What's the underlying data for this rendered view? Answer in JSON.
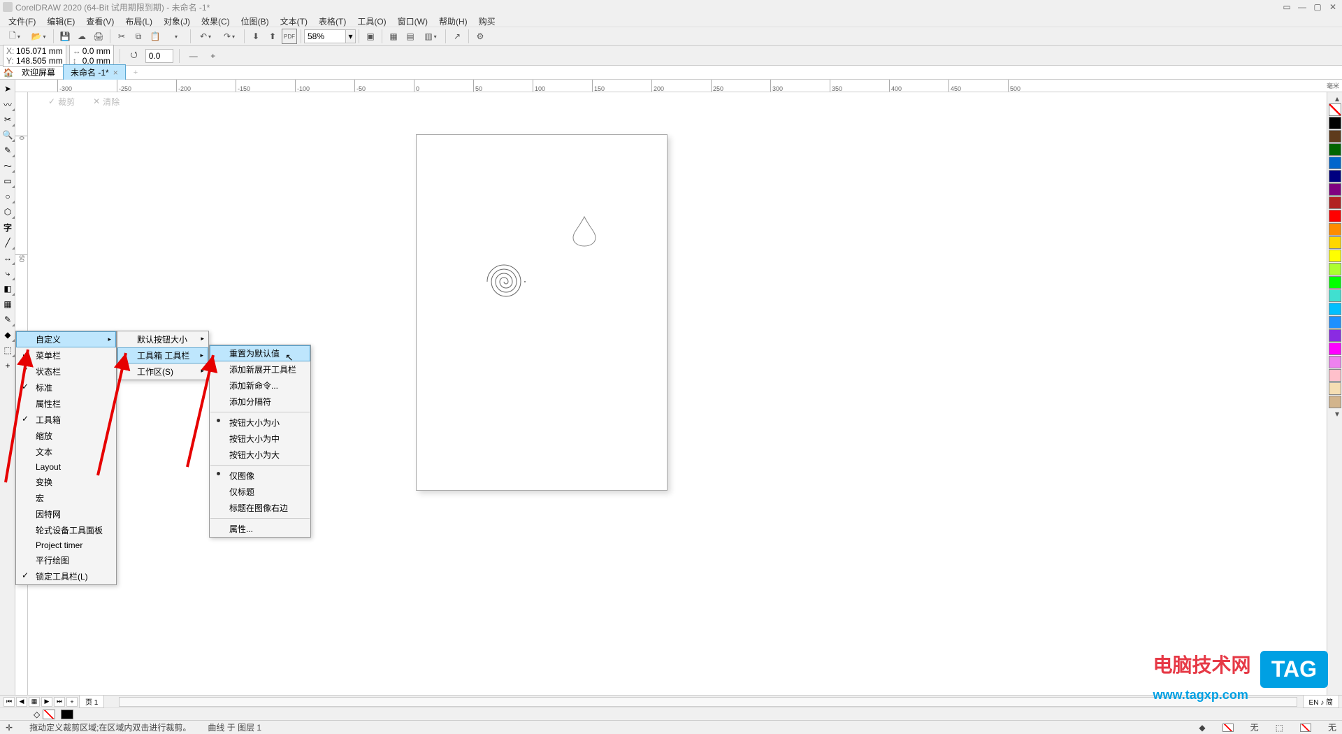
{
  "titlebar": {
    "title": "CorelDRAW 2020 (64-Bit 试用期限到期) - 未命名 -1*"
  },
  "menubar": {
    "items": [
      "文件(F)",
      "编辑(E)",
      "查看(V)",
      "布局(L)",
      "对象(J)",
      "效果(C)",
      "位图(B)",
      "文本(T)",
      "表格(T)",
      "工具(O)",
      "窗口(W)",
      "帮助(H)",
      "购买"
    ]
  },
  "toolbar": {
    "zoom": "58%"
  },
  "propbar": {
    "x_label": "X:",
    "x_val": "105.071 mm",
    "y_label": "Y:",
    "y_val": "148.505 mm",
    "w_label": "↔",
    "w_val": "0.0 mm",
    "h_label": "↕",
    "h_val": "0.0 mm",
    "angle": "0.0"
  },
  "tabs": {
    "welcome": "欢迎屏幕",
    "doc": "未命名 -1*"
  },
  "cropbar": {
    "crop": "裁剪",
    "clear": "清除"
  },
  "ruler_h": [
    "-300",
    "-250",
    "-200",
    "-150",
    "-100",
    "-50",
    "0",
    "50",
    "100",
    "150",
    "200",
    "250",
    "300",
    "350",
    "400",
    "450",
    "500"
  ],
  "ruler_h_unit": "毫米",
  "ruler_v": [
    "0",
    "50"
  ],
  "ctx1": {
    "items": [
      {
        "label": "自定义",
        "arrow": true,
        "hl": true
      },
      {
        "label": "菜单栏",
        "check": true
      },
      {
        "label": "状态栏",
        "check": true
      },
      {
        "label": "标准",
        "check": true
      },
      {
        "label": "属性栏"
      },
      {
        "label": "工具箱",
        "check": true
      },
      {
        "label": "缩放"
      },
      {
        "label": "文本"
      },
      {
        "label": "Layout"
      },
      {
        "label": "变换"
      },
      {
        "label": "宏"
      },
      {
        "label": "因特网"
      },
      {
        "label": "轮式设备工具面板"
      },
      {
        "label": "Project timer"
      },
      {
        "label": "平行绘图"
      },
      {
        "label": "锁定工具栏(L)",
        "check": true
      }
    ]
  },
  "ctx2": {
    "items": [
      {
        "label": "默认按钮大小",
        "arrow": true
      },
      {
        "label": "工具箱 工具栏",
        "arrow": true,
        "hl": true
      },
      {
        "label": "工作区(S)",
        "arrow": true
      }
    ]
  },
  "ctx3": {
    "items": [
      {
        "label": "重置为默认值",
        "hl": true
      },
      {
        "label": "添加新展开工具栏"
      },
      {
        "label": "添加新命令..."
      },
      {
        "label": "添加分隔符"
      },
      {
        "sep": true
      },
      {
        "label": "按钮大小为小",
        "bullet": true
      },
      {
        "label": "按钮大小为中"
      },
      {
        "label": "按钮大小为大"
      },
      {
        "sep": true
      },
      {
        "label": "仅图像",
        "bullet": true
      },
      {
        "label": "仅标题"
      },
      {
        "label": "标题在图像右边"
      },
      {
        "sep": true
      },
      {
        "label": "属性..."
      }
    ]
  },
  "pager": {
    "page_label": "页 1",
    "lang": "EN ♪ 简"
  },
  "statusbar": {
    "tip": "拖动定义裁剪区域;在区域内双击进行裁剪。",
    "layer": "曲线 于 图层 1",
    "none": "无"
  },
  "palette": [
    "#ffffff",
    "none",
    "#000000",
    "#8b4513",
    "#5e3b1c",
    "#006400",
    "#0066cc",
    "#000080",
    "#800080",
    "#b22222",
    "#ff8c00",
    "#ffd700",
    "#ffff00",
    "#adff2f",
    "#00ff00",
    "#40e0d0",
    "#00bfff",
    "#1e90ff",
    "#8a2be2",
    "#ff00ff",
    "#ee82ee",
    "#ffc0cb",
    "#f5deb3",
    "#d2b48c"
  ],
  "watermark": {
    "line1": "电脑技术网",
    "line2": "www.tagxp.com",
    "tag": "TAG"
  }
}
